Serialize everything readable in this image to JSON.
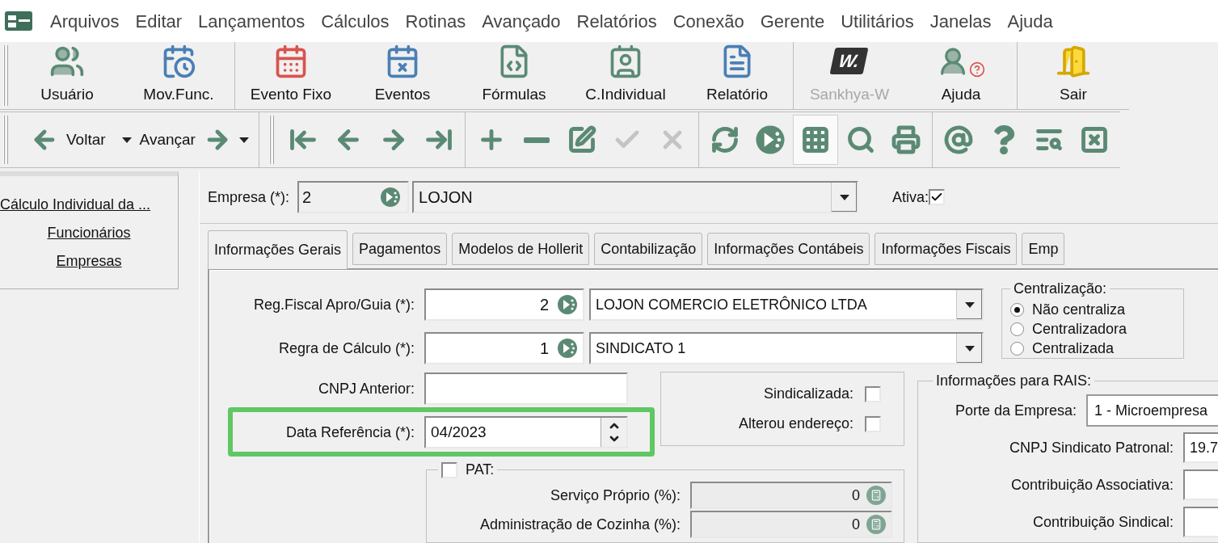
{
  "menu_bar": {
    "items": [
      "Arquivos",
      "Editar",
      "Lançamentos",
      "Cálculos",
      "Rotinas",
      "Avançado",
      "Relatórios",
      "Conexão",
      "Gerente",
      "Utilitários",
      "Janelas",
      "Ajuda"
    ]
  },
  "main_toolbar": {
    "buttons": [
      {
        "label": "Usuário",
        "disabled": false
      },
      {
        "label": "Mov.Func.",
        "disabled": false
      },
      {
        "label": "Evento Fixo",
        "disabled": false
      },
      {
        "label": "Eventos",
        "disabled": false
      },
      {
        "label": "Fórmulas",
        "disabled": false
      },
      {
        "label": "C.Individual",
        "disabled": false
      },
      {
        "label": "Relatório",
        "disabled": false
      },
      {
        "label": "Sankhya-W",
        "disabled": true,
        "logo_text": "W."
      },
      {
        "label": "Ajuda",
        "disabled": false
      },
      {
        "label": "Sair",
        "disabled": false
      }
    ]
  },
  "nav_toolbar": {
    "back": {
      "label": "Voltar"
    },
    "forward": {
      "label": "Avançar"
    },
    "tools": [
      {
        "disabled": false,
        "pressed": false
      },
      {
        "disabled": false,
        "pressed": false
      },
      {
        "disabled": false,
        "pressed": false
      },
      {
        "disabled": false,
        "pressed": false
      },
      {
        "disabled": false,
        "pressed": false
      },
      {
        "disabled": false,
        "pressed": false
      },
      {
        "disabled": false,
        "pressed": false
      },
      {
        "disabled": true,
        "pressed": false
      },
      {
        "disabled": true,
        "pressed": false
      },
      {
        "disabled": false,
        "pressed": false
      },
      {
        "disabled": false,
        "pressed": false
      },
      {
        "disabled": false,
        "pressed": true
      },
      {
        "disabled": false,
        "pressed": false
      },
      {
        "disabled": false,
        "pressed": false
      },
      {
        "disabled": false,
        "pressed": false
      },
      {
        "disabled": false,
        "pressed": false
      },
      {
        "disabled": false,
        "pressed": false
      },
      {
        "disabled": false,
        "pressed": false
      }
    ]
  },
  "side_panel": {
    "links": [
      "Cálculo Individual da ...",
      "Funcionários",
      "Empresas"
    ]
  },
  "company": {
    "label": "Empresa (*):",
    "code": "2",
    "name": "LOJON",
    "active_label": "Ativa:",
    "active": true
  },
  "tabs": [
    {
      "label": "Informações Gerais",
      "selected": true
    },
    {
      "label": "Pagamentos",
      "selected": false
    },
    {
      "label": "Modelos de Hollerit",
      "selected": false
    },
    {
      "label": "Contabilização",
      "selected": false
    },
    {
      "label": "Informações Contábeis",
      "selected": false
    },
    {
      "label": "Informações Fiscais",
      "selected": false
    },
    {
      "label": "Emp",
      "selected": false
    }
  ],
  "form": {
    "lookups": [
      {
        "label": "Reg.Fiscal Apro/Guia (*):",
        "code": "2",
        "name": "LOJON COMERCIO ELETRÔNICO LTDA"
      },
      {
        "label": "Regra de Cálculo (*):",
        "code": "1",
        "name": "SINDICATO 1"
      }
    ],
    "cnpj_anterior": {
      "label": "CNPJ Anterior:"
    },
    "data_referencia": {
      "label": "Data Referência (*):",
      "value": "04/2023"
    },
    "flags": [
      {
        "label": "Sindicalizada:",
        "checked": false
      },
      {
        "label": "Alterou endereço:",
        "checked": false
      }
    ],
    "pat": {
      "label": "PAT:",
      "checked": false,
      "rows": [
        {
          "label": "Serviço Próprio (%):",
          "value": "0"
        },
        {
          "label": "Administração de Cozinha (%):",
          "value": "0"
        }
      ]
    },
    "centralizacao": {
      "title": "Centralização:",
      "options": [
        {
          "label": "Não centraliza",
          "selected": true
        },
        {
          "label": "Centralizadora",
          "selected": false
        },
        {
          "label": "Centralizada",
          "selected": false
        }
      ]
    },
    "rais": {
      "title": "Informações para RAIS:",
      "fields": [
        {
          "kind": "combo",
          "label": "Porte da Empresa:",
          "value": "1 - Microempresa"
        },
        {
          "kind": "input",
          "label": "CNPJ Sindicato Patronal:",
          "value": "19.7"
        },
        {
          "kind": "input",
          "label": "Contribuição Associativa:"
        },
        {
          "kind": "input",
          "label": "Contribuição Sindical:"
        }
      ]
    }
  }
}
